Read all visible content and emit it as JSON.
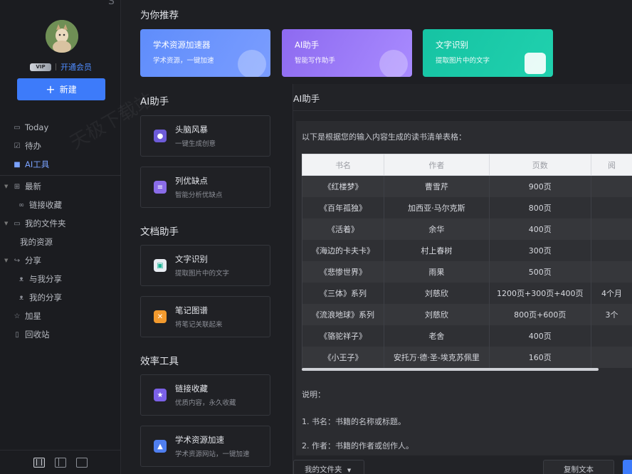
{
  "sidebar": {
    "top_glyph": "S",
    "vip_badge": "VIP",
    "vip_link": "开通会员",
    "new_button": "新建",
    "nav": [
      {
        "label": "Today",
        "icon": "calendar-icon"
      },
      {
        "label": "待办",
        "icon": "checkbox-icon"
      },
      {
        "label": "AI工具",
        "icon": "ai-tool-icon",
        "active": true
      },
      {
        "label": "最新",
        "icon": "grid-icon"
      },
      {
        "label": "链接收藏",
        "icon": "link-icon"
      },
      {
        "label": "我的文件夹",
        "icon": "folder-icon"
      },
      {
        "label": "我的资源",
        "icon": ""
      },
      {
        "label": "分享",
        "icon": "share-icon"
      },
      {
        "label": "与我分享",
        "icon": "user-icon"
      },
      {
        "label": "我的分享",
        "icon": "user-icon"
      },
      {
        "label": "加星",
        "icon": "star-icon"
      },
      {
        "label": "回收站",
        "icon": "trash-icon"
      }
    ]
  },
  "main": {
    "recommend_title": "为你推荐",
    "promos": [
      {
        "title": "学术资源加速器",
        "subtitle": "学术资源，一键加速"
      },
      {
        "title": "AI助手",
        "subtitle": "智能写作助手"
      },
      {
        "title": "文字识别",
        "subtitle": "提取图片中的文字"
      }
    ],
    "sections": {
      "ai": "AI助手",
      "doc": "文档助手",
      "efficiency": "效率工具"
    },
    "tools": [
      {
        "title": "头脑风暴",
        "subtitle": "一键生成创意"
      },
      {
        "title": "列优缺点",
        "subtitle": "智能分析优缺点"
      },
      {
        "title": "文字识别",
        "subtitle": "提取图片中的文字"
      },
      {
        "title": "笔记图谱",
        "subtitle": "将笔记关联起来"
      },
      {
        "title": "链接收藏",
        "subtitle": "优质内容，永久收藏"
      },
      {
        "title": "学术资源加速",
        "subtitle": "学术资源网站，一键加速"
      }
    ]
  },
  "ai_panel": {
    "title": "AI助手",
    "intro": "以下是根据您的输入内容生成的读书清单表格：",
    "table": {
      "headers": [
        "书名",
        "作者",
        "页数",
        "阅"
      ],
      "rows": [
        [
          "《红楼梦》",
          "曹雪芹",
          "900页",
          ""
        ],
        [
          "《百年孤独》",
          "加西亚·马尔克斯",
          "800页",
          ""
        ],
        [
          "《活着》",
          "余华",
          "400页",
          ""
        ],
        [
          "《海边的卡夫卡》",
          "村上春树",
          "300页",
          ""
        ],
        [
          "《悲惨世界》",
          "雨果",
          "500页",
          ""
        ],
        [
          "《三体》系列",
          "刘慈欣",
          "1200页+300页+400页",
          "4个月"
        ],
        [
          "《流浪地球》系列",
          "刘慈欣",
          "800页+600页",
          "3个"
        ],
        [
          "《骆驼祥子》",
          "老舍",
          "400页",
          ""
        ],
        [
          "《小王子》",
          "安托万·德·圣-埃克苏佩里",
          "160页",
          ""
        ]
      ]
    },
    "note_title": "说明：",
    "notes": [
      "1. 书名：书籍的名称或标题。",
      "2. 作者：书籍的作者或创作人。"
    ],
    "folder_select": "我的文件夹",
    "copy_button": "复制文本"
  },
  "watermark": "天极下载站"
}
